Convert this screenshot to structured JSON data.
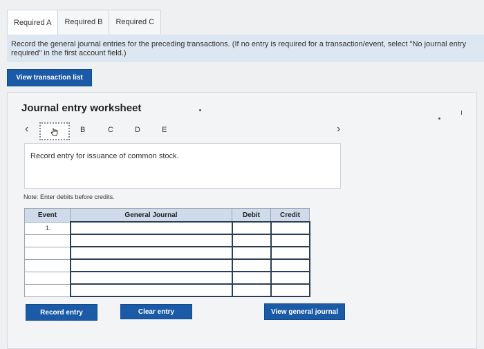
{
  "tabs": [
    "Required A",
    "Required B",
    "Required C"
  ],
  "instructions": {
    "line1": "Record the general journal entries for the preceding transactions. (If no entry is required for a transaction/event, select \"No journal entry",
    "line2": "required\" in the first account field.)"
  },
  "view_transaction_button": "View transaction list",
  "worksheet": {
    "title": "Journal entry worksheet",
    "steps": [
      "B",
      "C",
      "D",
      "E"
    ],
    "entry_description": "Record entry for issuance of common stock.",
    "note": "Note: Enter debits before credits."
  },
  "journal_table": {
    "headers": [
      "Event",
      "General Journal",
      "Debit",
      "Credit"
    ],
    "rows": [
      {
        "event": "1.",
        "account": "",
        "debit": "",
        "credit": ""
      },
      {
        "event": "",
        "account": "",
        "debit": "",
        "credit": ""
      },
      {
        "event": "",
        "account": "",
        "debit": "",
        "credit": ""
      },
      {
        "event": "",
        "account": "",
        "debit": "",
        "credit": ""
      },
      {
        "event": "",
        "account": "",
        "debit": "",
        "credit": ""
      },
      {
        "event": "",
        "account": "",
        "debit": "",
        "credit": ""
      }
    ]
  },
  "buttons": {
    "record": "Record entry",
    "clear": "Clear entry",
    "view_journal": "View general journal"
  },
  "colors": {
    "button_blue": "#1b5aa6",
    "header_blue": "#cfdbea",
    "instruction_band": "#dde7f1"
  }
}
